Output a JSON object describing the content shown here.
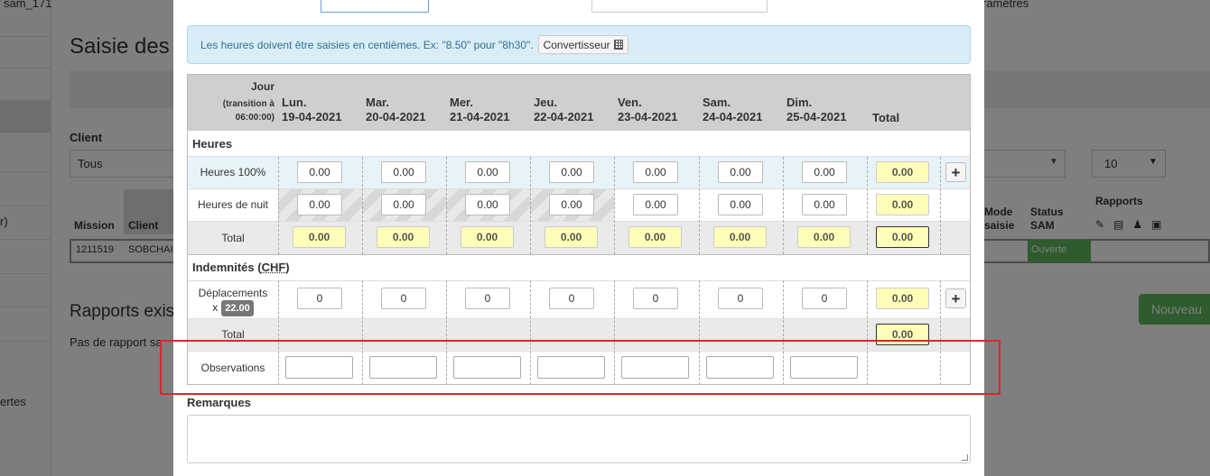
{
  "background": {
    "top_left": "sam_171",
    "top_right": "ramètres",
    "page_title": "Saisie des",
    "client_label": "Client",
    "client_value": "Tous",
    "left_items": [
      "r)",
      "ertes"
    ],
    "col_mission": "Mission",
    "col_client": "Client",
    "mission_id": "1211519",
    "mission_client": "SOBCHAI",
    "col_mode": "Mode saisie",
    "col_status": "Status SAM",
    "col_rapports": "Rapports",
    "status_value": "Ouverte",
    "page_size": "10",
    "rapports_title": "Rapports exis",
    "rapports_empty": "Pas de rapport sa",
    "new_button": "Nouveau",
    "accent_green": "#5cb85c"
  },
  "alert": {
    "text": "Les heures doivent être saisies en centièmes. Ex: \"8.50\" pour \"8h30\".",
    "converter_label": "Convertisseur"
  },
  "table": {
    "jour_label": "Jour",
    "transition_label": "(transition à 06:00:00)",
    "total_label": "Total",
    "days": [
      {
        "name": "Lun.",
        "date": "19-04-2021"
      },
      {
        "name": "Mar.",
        "date": "20-04-2021"
      },
      {
        "name": "Mer.",
        "date": "21-04-2021"
      },
      {
        "name": "Jeu.",
        "date": "22-04-2021"
      },
      {
        "name": "Ven.",
        "date": "23-04-2021"
      },
      {
        "name": "Sam.",
        "date": "24-04-2021"
      },
      {
        "name": "Dim.",
        "date": "25-04-2021"
      }
    ],
    "section_heures": "Heures",
    "row_heures100": {
      "label": "Heures 100%",
      "values": [
        "0.00",
        "0.00",
        "0.00",
        "0.00",
        "0.00",
        "0.00",
        "0.00"
      ],
      "total": "0.00"
    },
    "row_nuit": {
      "label": "Heures de nuit",
      "values": [
        "0.00",
        "0.00",
        "0.00",
        "0.00",
        "0.00",
        "0.00",
        "0.00"
      ],
      "total": "0.00"
    },
    "row_total_heures": {
      "label": "Total",
      "values": [
        "0.00",
        "0.00",
        "0.00",
        "0.00",
        "0.00",
        "0.00",
        "0.00"
      ],
      "total": "0.00"
    },
    "section_indemnites": "Indemnités (",
    "indemnites_currency": "CHF",
    "indemnites_close": ")",
    "row_deplacements": {
      "label": "Déplacements",
      "multiplier_prefix": "x",
      "multiplier": "22.00",
      "values": [
        "0",
        "0",
        "0",
        "0",
        "0",
        "0",
        "0"
      ],
      "total": "0.00"
    },
    "row_total_indemnites": {
      "label": "Total",
      "total": "0.00"
    },
    "row_observations": {
      "label": "Observations"
    },
    "add_icon": "plus-icon"
  },
  "remarks": {
    "label": "Remarques"
  },
  "highlight_color": "#e3232c"
}
